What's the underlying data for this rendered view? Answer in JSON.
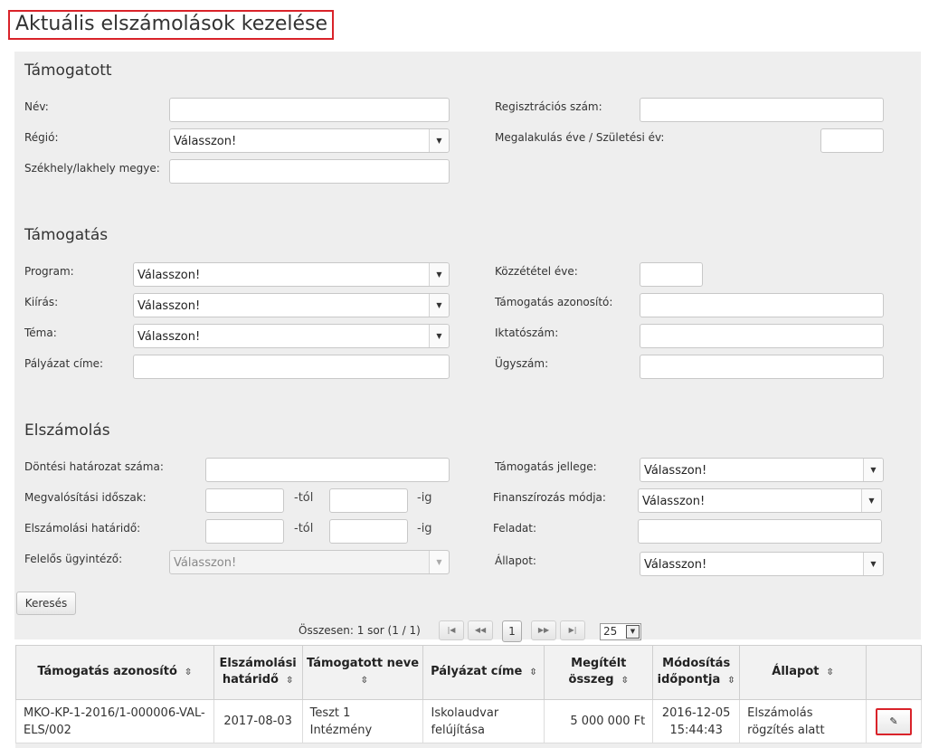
{
  "page": {
    "title": "Aktuális elszámolások kezelése"
  },
  "placeholder_select": "Válasszon!",
  "tamogatott": {
    "title": "Támogatott",
    "nev_label": "Név:",
    "regio_label": "Régió:",
    "regio_value": "Válasszon!",
    "szekhely_label": "Székhely/lakhely megye:",
    "regszam_label": "Regisztrációs szám:",
    "megalakulas_label": "Megalakulás éve / Születési év:"
  },
  "tamogatas": {
    "title": "Támogatás",
    "program_label": "Program:",
    "program_value": "Válasszon!",
    "kiiras_label": "Kiírás:",
    "kiiras_value": "Válasszon!",
    "tema_label": "Téma:",
    "tema_value": "Válasszon!",
    "palyazat_label": "Pályázat címe:",
    "kozzetetel_label": "Közzététel éve:",
    "azonosito_label": "Támogatás azonosító:",
    "iktatoszam_label": "Iktatószám:",
    "ugyszam_label": "Ügyszám:"
  },
  "elszamolas": {
    "title": "Elszámolás",
    "dontesi_label": "Döntési határozat száma:",
    "megvalositasi_label": "Megvalósítási időszak:",
    "hatarido_label": "Elszámolási határidő:",
    "felelos_label": "Felelős ügyintéző:",
    "felelos_value": "Válasszon!",
    "tol": "-tól",
    "ig": "-ig",
    "jelleg_label": "Támogatás jellege:",
    "jelleg_value": "Válasszon!",
    "finansz_label": "Finanszírozás módja:",
    "finansz_value": "Válasszon!",
    "feladat_label": "Feladat:",
    "allapot_label": "Állapot:",
    "allapot_value": "Válasszon!"
  },
  "search_button": "Keresés",
  "pager": {
    "summary": "Összesen: 1 sor (1 / 1)",
    "first": "|◀",
    "prev": "◀◀",
    "current": "1",
    "next": "▶▶",
    "last": "▶|",
    "page_size": "25"
  },
  "table": {
    "columns": [
      "Támogatás azonosító",
      "Elszámolási határidő",
      "Támogatott neve",
      "Pályázat címe",
      "Megítélt összeg",
      "Módosítás időpontja",
      "Állapot"
    ],
    "rows": [
      {
        "azonosito": "MKO-KP-1-2016/1-000006-VAL-ELS/002",
        "hatarido": "2017-08-03",
        "nev": "Teszt 1 Intézmény",
        "palyazat": "Iskolaudvar felújítása",
        "osszeg": "5 000 000 Ft",
        "modositas_datum": "2016-12-05",
        "modositas_ido": "15:44:43",
        "allapot": "Elszámolás rögzítés alatt"
      }
    ]
  },
  "colors": {
    "accent_red": "#d9232a",
    "panel_bg": "#eeeeee"
  },
  "icons": {
    "sort": "sort-icon",
    "edit": "pencil-icon",
    "dropdown": "chevron-down-icon"
  }
}
